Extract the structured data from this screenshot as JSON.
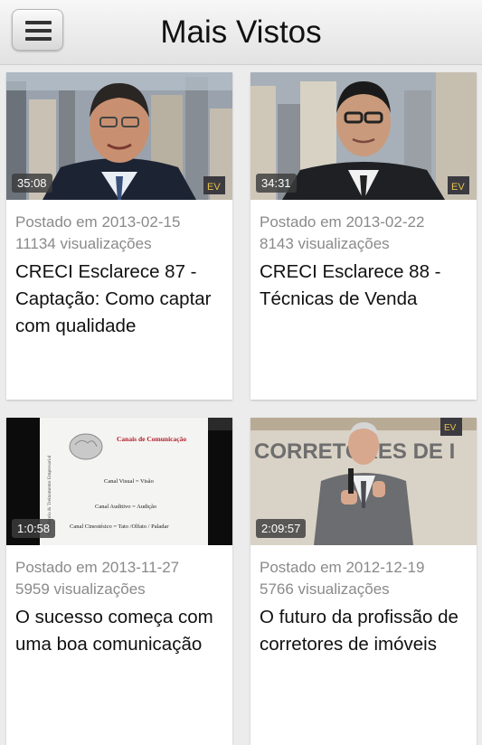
{
  "header": {
    "title": "Mais Vistos",
    "menu_icon": "hamburger-menu-icon"
  },
  "videos": [
    {
      "duration": "35:08",
      "posted": "Postado em 2013-02-15",
      "views": "11134 visualizações",
      "title": "CRECI Esclarece 87 - Captação: Como captar com qualidade"
    },
    {
      "duration": "34:31",
      "posted": "Postado em 2013-02-22",
      "views": "8143 visualizações",
      "title": "CRECI Esclarece 88 - Técnicas de Venda"
    },
    {
      "duration": "1:0:58",
      "posted": "Postado em 2013-11-27",
      "views": "5959 visualizações",
      "title": "O sucesso começa com uma boa comunicação",
      "slide": {
        "heading": "Canais de Comunicação",
        "line1": "Canal Visual = Visão",
        "line2": "Canal Auditivo = Audição",
        "line3": "Canal Cinestésico = Tato /Olfato / Paladar",
        "side": "Consultoria & Treinamento Empresarial"
      }
    },
    {
      "duration": "2:09:57",
      "posted": "Postado em 2012-12-19",
      "views": "5766 visualizações",
      "title": "O futuro da profissão de corretores de imóveis",
      "banner": "CORRETORES DE I"
    }
  ]
}
